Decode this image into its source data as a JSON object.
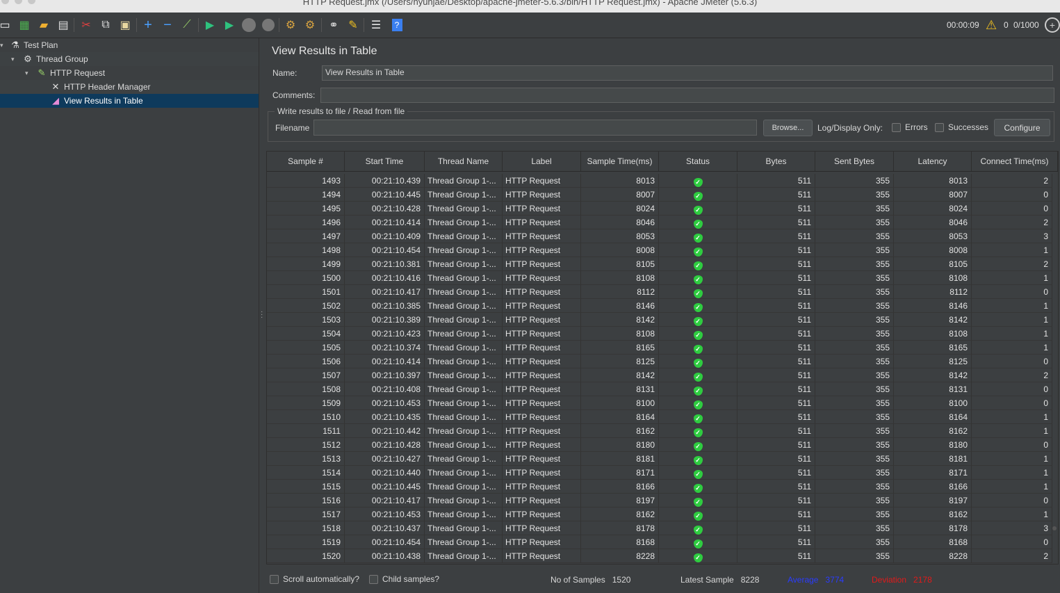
{
  "window": {
    "title": "HTTP Request.jmx (/Users/hyunjae/Desktop/apache-jmeter-5.6.3/bin/HTTP Request.jmx) - Apache JMeter (5.6.3)"
  },
  "toolbar": {
    "elapsed": "00:00:09",
    "warnings": "0",
    "threads": "0/1000",
    "icons": [
      "new-icon",
      "templates-icon",
      "open-icon",
      "save-icon",
      "cut-icon",
      "copy-icon",
      "paste-icon",
      "expand-icon",
      "collapse-icon",
      "toggle-icon",
      "start-icon",
      "start-no-pause-icon",
      "stop-icon",
      "shutdown-icon",
      "clear-icon",
      "clear-all-icon",
      "search-icon",
      "reset-search-icon",
      "function-helper-icon",
      "help-icon"
    ]
  },
  "tree": {
    "items": [
      {
        "label": "Test Plan",
        "icon": "flask-icon"
      },
      {
        "label": "Thread Group",
        "icon": "gear-icon"
      },
      {
        "label": "HTTP Request",
        "icon": "pipette-icon"
      },
      {
        "label": "HTTP Header Manager",
        "icon": "tools-icon"
      },
      {
        "label": "View Results in Table",
        "icon": "chart-icon"
      }
    ]
  },
  "panel": {
    "title": "View Results in Table",
    "name_label": "Name:",
    "name_value": "View Results in Table",
    "comments_label": "Comments:",
    "comments_value": "",
    "file_group_label": "Write results to file / Read from file",
    "filename_label": "Filename",
    "filename_value": "",
    "browse_label": "Browse...",
    "log_display_label": "Log/Display Only:",
    "errors_label": "Errors",
    "successes_label": "Successes",
    "configure_label": "Configure"
  },
  "table": {
    "columns": [
      "Sample #",
      "Start Time",
      "Thread Name",
      "Label",
      "Sample Time(ms)",
      "Status",
      "Bytes",
      "Sent Bytes",
      "Latency",
      "Connect Time(ms)"
    ],
    "rows": [
      [
        "1493",
        "00:21:10.439",
        "Thread Group 1-...",
        "HTTP Request",
        "8013",
        "ok",
        "511",
        "355",
        "8013",
        "2"
      ],
      [
        "1494",
        "00:21:10.445",
        "Thread Group 1-...",
        "HTTP Request",
        "8007",
        "ok",
        "511",
        "355",
        "8007",
        "0"
      ],
      [
        "1495",
        "00:21:10.428",
        "Thread Group 1-...",
        "HTTP Request",
        "8024",
        "ok",
        "511",
        "355",
        "8024",
        "0"
      ],
      [
        "1496",
        "00:21:10.414",
        "Thread Group 1-...",
        "HTTP Request",
        "8046",
        "ok",
        "511",
        "355",
        "8046",
        "2"
      ],
      [
        "1497",
        "00:21:10.409",
        "Thread Group 1-...",
        "HTTP Request",
        "8053",
        "ok",
        "511",
        "355",
        "8053",
        "3"
      ],
      [
        "1498",
        "00:21:10.454",
        "Thread Group 1-...",
        "HTTP Request",
        "8008",
        "ok",
        "511",
        "355",
        "8008",
        "1"
      ],
      [
        "1499",
        "00:21:10.381",
        "Thread Group 1-...",
        "HTTP Request",
        "8105",
        "ok",
        "511",
        "355",
        "8105",
        "2"
      ],
      [
        "1500",
        "00:21:10.416",
        "Thread Group 1-...",
        "HTTP Request",
        "8108",
        "ok",
        "511",
        "355",
        "8108",
        "1"
      ],
      [
        "1501",
        "00:21:10.417",
        "Thread Group 1-...",
        "HTTP Request",
        "8112",
        "ok",
        "511",
        "355",
        "8112",
        "0"
      ],
      [
        "1502",
        "00:21:10.385",
        "Thread Group 1-...",
        "HTTP Request",
        "8146",
        "ok",
        "511",
        "355",
        "8146",
        "1"
      ],
      [
        "1503",
        "00:21:10.389",
        "Thread Group 1-...",
        "HTTP Request",
        "8142",
        "ok",
        "511",
        "355",
        "8142",
        "1"
      ],
      [
        "1504",
        "00:21:10.423",
        "Thread Group 1-...",
        "HTTP Request",
        "8108",
        "ok",
        "511",
        "355",
        "8108",
        "1"
      ],
      [
        "1505",
        "00:21:10.374",
        "Thread Group 1-...",
        "HTTP Request",
        "8165",
        "ok",
        "511",
        "355",
        "8165",
        "1"
      ],
      [
        "1506",
        "00:21:10.414",
        "Thread Group 1-...",
        "HTTP Request",
        "8125",
        "ok",
        "511",
        "355",
        "8125",
        "0"
      ],
      [
        "1507",
        "00:21:10.397",
        "Thread Group 1-...",
        "HTTP Request",
        "8142",
        "ok",
        "511",
        "355",
        "8142",
        "2"
      ],
      [
        "1508",
        "00:21:10.408",
        "Thread Group 1-...",
        "HTTP Request",
        "8131",
        "ok",
        "511",
        "355",
        "8131",
        "0"
      ],
      [
        "1509",
        "00:21:10.453",
        "Thread Group 1-...",
        "HTTP Request",
        "8100",
        "ok",
        "511",
        "355",
        "8100",
        "0"
      ],
      [
        "1510",
        "00:21:10.435",
        "Thread Group 1-...",
        "HTTP Request",
        "8164",
        "ok",
        "511",
        "355",
        "8164",
        "1"
      ],
      [
        "1511",
        "00:21:10.442",
        "Thread Group 1-...",
        "HTTP Request",
        "8162",
        "ok",
        "511",
        "355",
        "8162",
        "1"
      ],
      [
        "1512",
        "00:21:10.428",
        "Thread Group 1-...",
        "HTTP Request",
        "8180",
        "ok",
        "511",
        "355",
        "8180",
        "0"
      ],
      [
        "1513",
        "00:21:10.427",
        "Thread Group 1-...",
        "HTTP Request",
        "8181",
        "ok",
        "511",
        "355",
        "8181",
        "1"
      ],
      [
        "1514",
        "00:21:10.440",
        "Thread Group 1-...",
        "HTTP Request",
        "8171",
        "ok",
        "511",
        "355",
        "8171",
        "1"
      ],
      [
        "1515",
        "00:21:10.445",
        "Thread Group 1-...",
        "HTTP Request",
        "8166",
        "ok",
        "511",
        "355",
        "8166",
        "1"
      ],
      [
        "1516",
        "00:21:10.417",
        "Thread Group 1-...",
        "HTTP Request",
        "8197",
        "ok",
        "511",
        "355",
        "8197",
        "0"
      ],
      [
        "1517",
        "00:21:10.453",
        "Thread Group 1-...",
        "HTTP Request",
        "8162",
        "ok",
        "511",
        "355",
        "8162",
        "1"
      ],
      [
        "1518",
        "00:21:10.437",
        "Thread Group 1-...",
        "HTTP Request",
        "8178",
        "ok",
        "511",
        "355",
        "8178",
        "3"
      ],
      [
        "1519",
        "00:21:10.454",
        "Thread Group 1-...",
        "HTTP Request",
        "8168",
        "ok",
        "511",
        "355",
        "8168",
        "0"
      ],
      [
        "1520",
        "00:21:10.438",
        "Thread Group 1-...",
        "HTTP Request",
        "8228",
        "ok",
        "511",
        "355",
        "8228",
        "2"
      ]
    ]
  },
  "footer": {
    "scroll_auto_label": "Scroll automatically?",
    "child_samples_label": "Child samples?",
    "samples_label": "No of Samples",
    "samples_value": "1520",
    "latest_label": "Latest Sample",
    "latest_value": "8228",
    "average_label": "Average",
    "average_value": "3774",
    "deviation_label": "Deviation",
    "deviation_value": "2178"
  },
  "colors": {
    "background": "#3c3f41",
    "selection": "#0e3a5c",
    "status_ok": "#2ecc40",
    "average": "#2a3cff",
    "deviation": "#e31a1a"
  }
}
